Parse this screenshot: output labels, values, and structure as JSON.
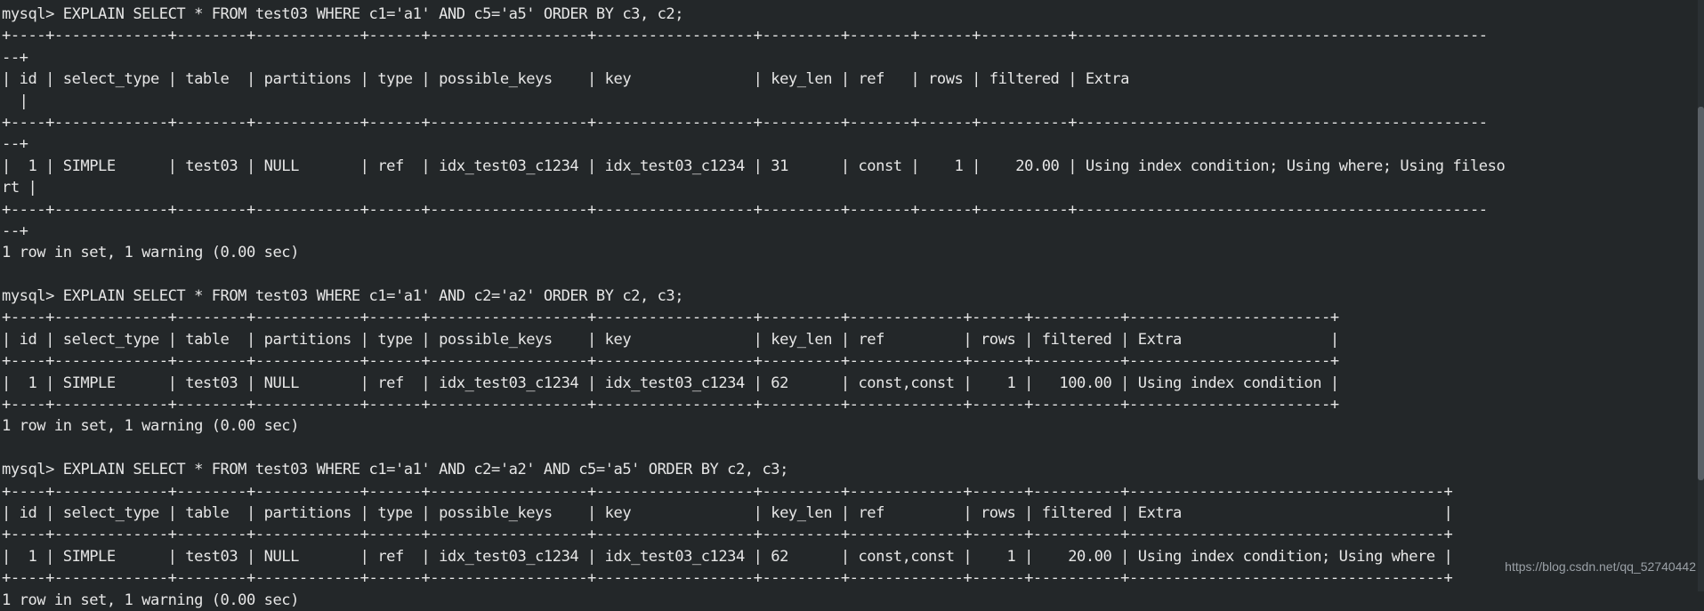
{
  "terminal": {
    "background_color": "#232729",
    "foreground_color": "#e6e6e6",
    "prompt": "mysql>",
    "columns": 181
  },
  "watermark": {
    "text": "https://blog.csdn.net/qq_52740442",
    "color": "#9aa0a6"
  },
  "blocks": [
    {
      "command": "mysql> EXPLAIN SELECT * FROM test03 WHERE c1='a1' AND c5='a5' ORDER BY c3, c2;",
      "columns": [
        "id",
        "select_type",
        "table",
        "partitions",
        "type",
        "possible_keys",
        "key",
        "key_len",
        "ref",
        "rows",
        "filtered",
        "Extra"
      ],
      "rows": [
        {
          "id": "1",
          "select_type": "SIMPLE",
          "table": "test03",
          "partitions": "NULL",
          "type": "ref",
          "possible_keys": "idx_test03_c1234",
          "key": "idx_test03_c1234",
          "key_len": "31",
          "ref": "const",
          "rows": "1",
          "filtered": "20.00",
          "Extra": "Using index condition; Using where; Using filesort"
        }
      ],
      "status": "1 row in set, 1 warning (0.00 sec)",
      "wrapped": true
    },
    {
      "command": "mysql> EXPLAIN SELECT * FROM test03 WHERE c1='a1' AND c2='a2' ORDER BY c2, c3;",
      "columns": [
        "id",
        "select_type",
        "table",
        "partitions",
        "type",
        "possible_keys",
        "key",
        "key_len",
        "ref",
        "rows",
        "filtered",
        "Extra"
      ],
      "rows": [
        {
          "id": "1",
          "select_type": "SIMPLE",
          "table": "test03",
          "partitions": "NULL",
          "type": "ref",
          "possible_keys": "idx_test03_c1234",
          "key": "idx_test03_c1234",
          "key_len": "62",
          "ref": "const,const",
          "rows": "1",
          "filtered": "100.00",
          "Extra": "Using index condition"
        }
      ],
      "status": "1 row in set, 1 warning (0.00 sec)",
      "wrapped": false
    },
    {
      "command": "mysql> EXPLAIN SELECT * FROM test03 WHERE c1='a1' AND c2='a2' AND c5='a5' ORDER BY c2, c3;",
      "columns": [
        "id",
        "select_type",
        "table",
        "partitions",
        "type",
        "possible_keys",
        "key",
        "key_len",
        "ref",
        "rows",
        "filtered",
        "Extra"
      ],
      "rows": [
        {
          "id": "1",
          "select_type": "SIMPLE",
          "table": "test03",
          "partitions": "NULL",
          "type": "ref",
          "possible_keys": "idx_test03_c1234",
          "key": "idx_test03_c1234",
          "key_len": "62",
          "ref": "const,const",
          "rows": "1",
          "filtered": "20.00",
          "Extra": "Using index condition; Using where"
        }
      ],
      "status": "1 row in set, 1 warning (0.00 sec)",
      "wrapped": false
    }
  ],
  "lines": [
    "mysql> EXPLAIN SELECT * FROM test03 WHERE c1='a1' AND c5='a5' ORDER BY c3, c2;",
    "+----+-------------+--------+------------+------+------------------+------------------+---------+-------+------+----------+-----------------------------------------------",
    "--+",
    "| id | select_type | table  | partitions | type | possible_keys    | key              | key_len | ref   | rows | filtered | Extra                                           ",
    "  |",
    "+----+-------------+--------+------------+------+------------------+------------------+---------+-------+------+----------+-----------------------------------------------",
    "--+",
    "|  1 | SIMPLE      | test03 | NULL       | ref  | idx_test03_c1234 | idx_test03_c1234 | 31      | const |    1 |    20.00 | Using index condition; Using where; Using fileso",
    "rt |",
    "+----+-------------+--------+------------+------+------------------+------------------+---------+-------+------+----------+-----------------------------------------------",
    "--+",
    "1 row in set, 1 warning (0.00 sec)",
    "",
    "mysql> EXPLAIN SELECT * FROM test03 WHERE c1='a1' AND c2='a2' ORDER BY c2, c3;",
    "+----+-------------+--------+------------+------+------------------+------------------+---------+-------------+------+----------+-----------------------+",
    "| id | select_type | table  | partitions | type | possible_keys    | key              | key_len | ref         | rows | filtered | Extra                 |",
    "+----+-------------+--------+------------+------+------------------+------------------+---------+-------------+------+----------+-----------------------+",
    "|  1 | SIMPLE      | test03 | NULL       | ref  | idx_test03_c1234 | idx_test03_c1234 | 62      | const,const |    1 |   100.00 | Using index condition |",
    "+----+-------------+--------+------------+------+------------------+------------------+---------+-------------+------+----------+-----------------------+",
    "1 row in set, 1 warning (0.00 sec)",
    "",
    "mysql> EXPLAIN SELECT * FROM test03 WHERE c1='a1' AND c2='a2' AND c5='a5' ORDER BY c2, c3;",
    "+----+-------------+--------+------------+------+------------------+------------------+---------+-------------+------+----------+------------------------------------+",
    "| id | select_type | table  | partitions | type | possible_keys    | key              | key_len | ref         | rows | filtered | Extra                              |",
    "+----+-------------+--------+------------+------+------------------+------------------+---------+-------------+------+----------+------------------------------------+",
    "|  1 | SIMPLE      | test03 | NULL       | ref  | idx_test03_c1234 | idx_test03_c1234 | 62      | const,const |    1 |    20.00 | Using index condition; Using where |",
    "+----+-------------+--------+------------+------+------------------+------------------+---------+-------------+------+----------+------------------------------------+",
    "1 row in set, 1 warning (0.00 sec)"
  ]
}
